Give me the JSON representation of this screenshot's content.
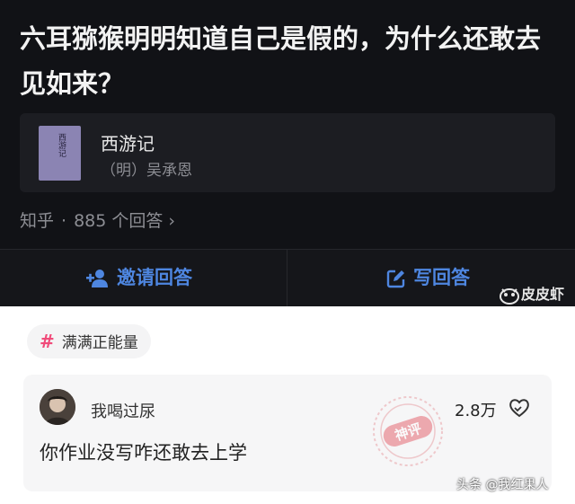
{
  "question": {
    "title": "六耳猕猴明明知道自己是假的，为什么还敢去见如来？"
  },
  "book": {
    "cover_text": "西游记",
    "title": "西游记",
    "author": "（明）吴承恩"
  },
  "meta": {
    "source": "知乎",
    "separator": "·",
    "answers": "885 个回答",
    "chevron": "›"
  },
  "actions": {
    "invite_label": "邀请回答",
    "write_label": "写回答",
    "accent_color": "#4e86e0"
  },
  "watermarks": {
    "pipi": "皮皮虾",
    "toutiao": "头条 @我红果人"
  },
  "topic": {
    "hash": "#",
    "label": "满满正能量",
    "hash_color": "#f04b7a"
  },
  "comment": {
    "username": "我喝过尿",
    "likes": "2.8万",
    "text": "你作业没写咋还敢去上学",
    "stamp_text": "神评"
  }
}
